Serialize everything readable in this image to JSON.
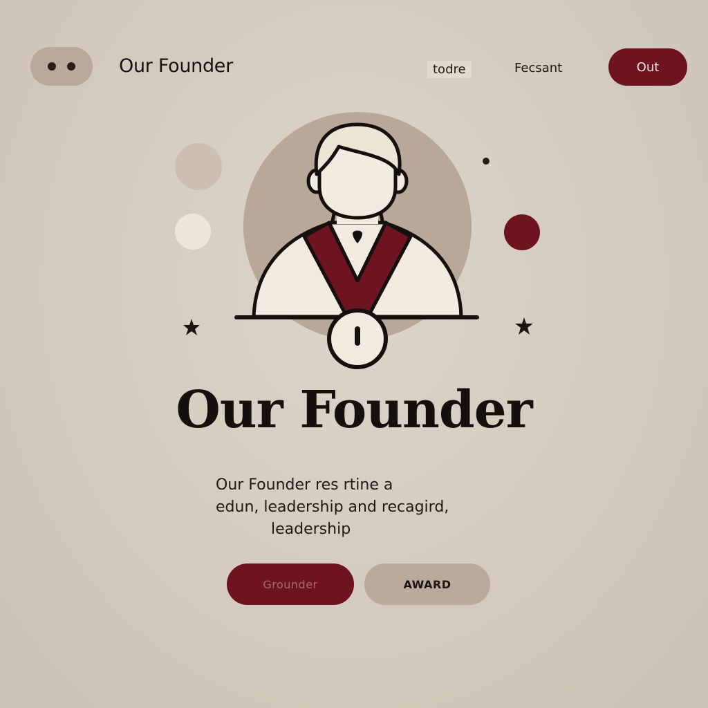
{
  "nav": {
    "brand": "Our Founder",
    "links": [
      "todre",
      "Fecsant"
    ],
    "cta_label": "Out"
  },
  "hero": {
    "headline": "Our Founder",
    "description_lines": [
      "Our Founder res rtine a",
      "edun, leadership and recagird,",
      "leadership"
    ],
    "primary_button": "Grounder",
    "secondary_button": "AWARD"
  },
  "colors": {
    "background": "#d3cabd",
    "accent": "#6e1420",
    "muted": "#b9aa9c",
    "ink": "#150f0d"
  },
  "icons": [
    "founder-avatar-icon",
    "medal-icon",
    "star-icon",
    "sparkle-icon"
  ]
}
